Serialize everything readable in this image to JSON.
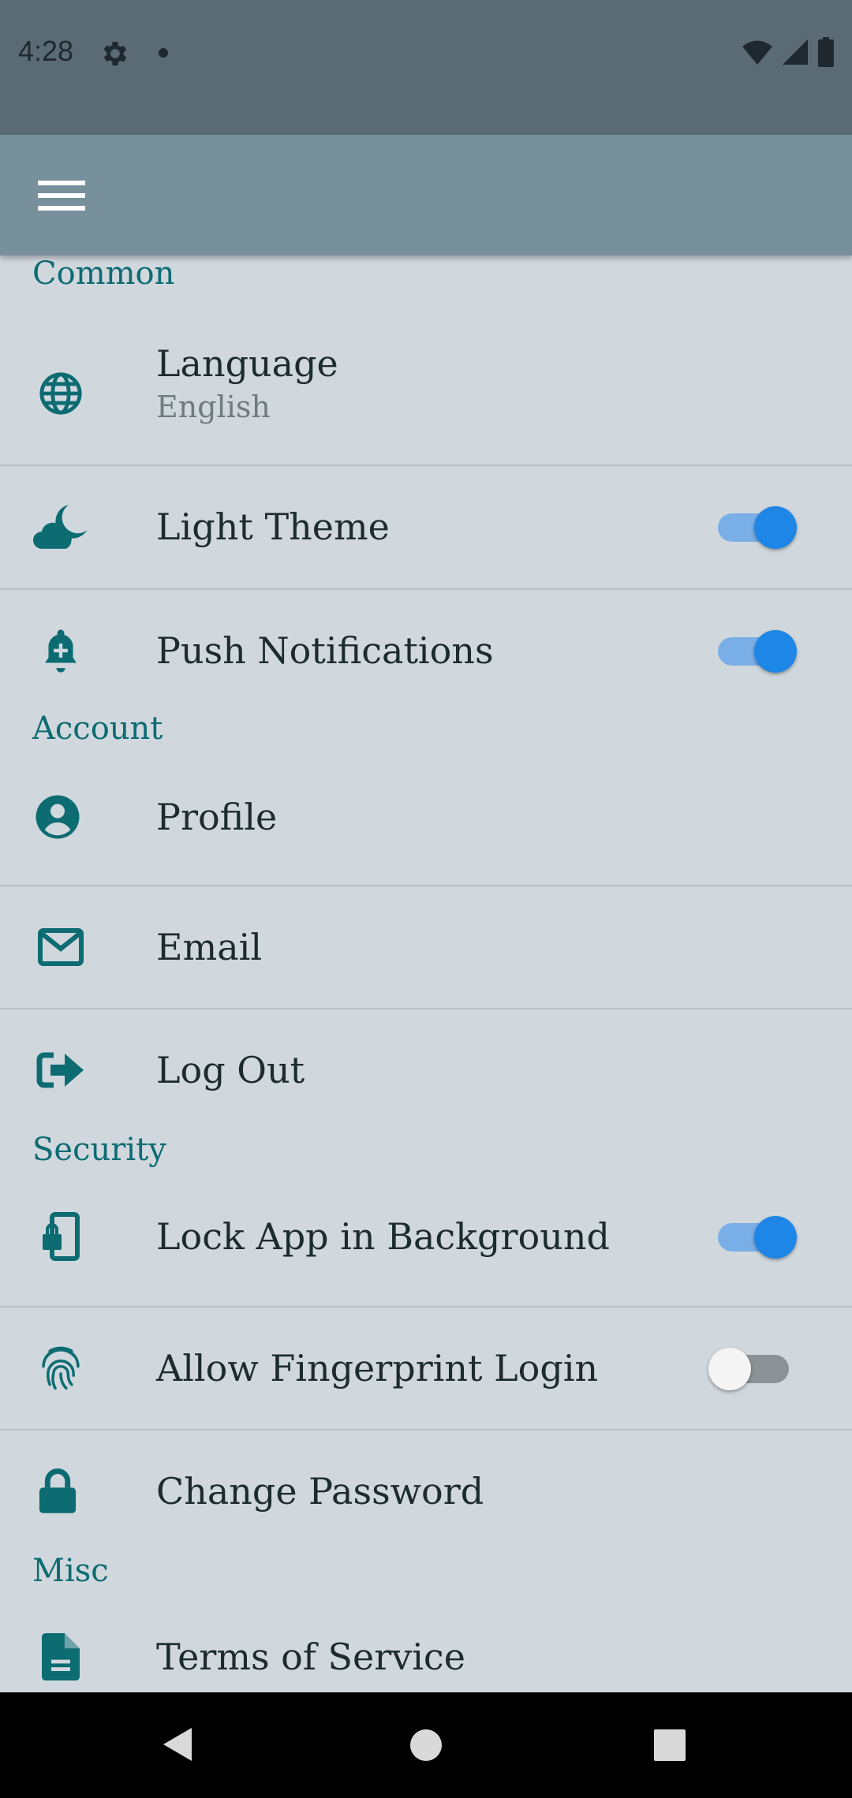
{
  "status_bar": {
    "time": "4:28",
    "icons": [
      "settings-icon",
      "notification-dot",
      "wifi-icon",
      "signal-icon",
      "battery-icon"
    ]
  },
  "app_bar": {
    "menu_icon": "hamburger-menu-icon"
  },
  "colors": {
    "status_bar_bg": "#5b6b75",
    "app_bar_bg": "#78909c",
    "background": "#d0d8de",
    "accent": "#0d6b72",
    "switch_on": "#1e86e6",
    "text": "#1d2a30"
  },
  "sections": {
    "common": {
      "title": "Common",
      "items": [
        {
          "icon": "globe-icon",
          "label": "Language",
          "value": "English"
        },
        {
          "icon": "cloud-moon-icon",
          "label": "Light Theme",
          "toggle": true
        },
        {
          "icon": "bell-plus-icon",
          "label": "Push Notifications",
          "toggle": true
        }
      ]
    },
    "account": {
      "title": "Account",
      "items": [
        {
          "icon": "user-circle-icon",
          "label": "Profile"
        },
        {
          "icon": "envelope-icon",
          "label": "Email"
        },
        {
          "icon": "logout-icon",
          "label": "Log Out"
        }
      ]
    },
    "security": {
      "title": "Security",
      "items": [
        {
          "icon": "phone-lock-icon",
          "label": "Lock App in Background",
          "toggle": true
        },
        {
          "icon": "fingerprint-icon",
          "label": "Allow Fingerprint Login",
          "toggle": false
        },
        {
          "icon": "lock-icon",
          "label": "Change Password"
        }
      ]
    },
    "misc": {
      "title": "Misc",
      "items": [
        {
          "icon": "document-icon",
          "label": "Terms of Service"
        }
      ]
    }
  },
  "nav_bar": {
    "icons": [
      "back-icon",
      "home-icon",
      "recents-icon"
    ]
  }
}
